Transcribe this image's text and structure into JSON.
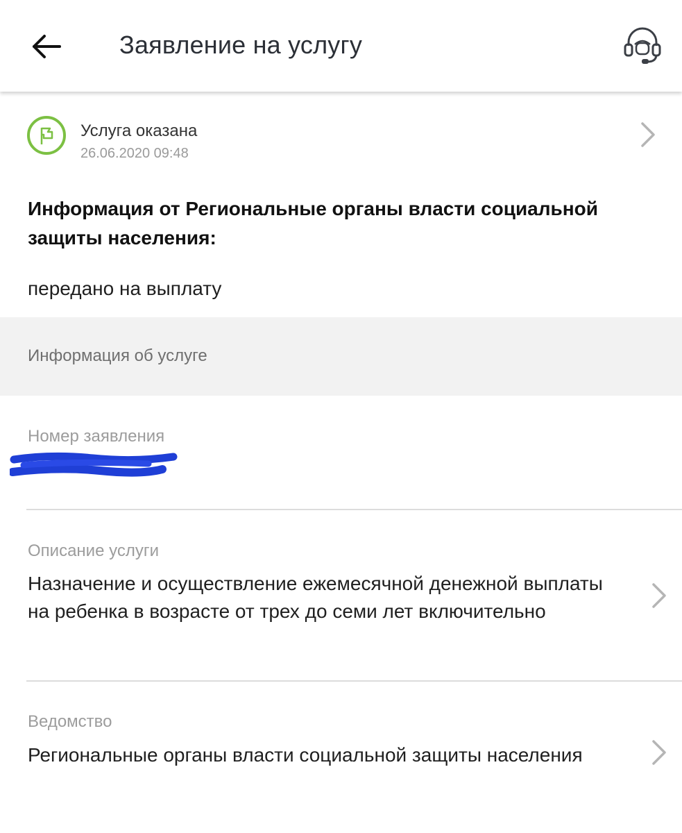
{
  "header": {
    "title": "Заявление на услугу",
    "back_icon": "arrow-left-icon",
    "support_icon": "headset-icon"
  },
  "status": {
    "title": "Услуга оказана",
    "date": "26.06.2020 09:48",
    "icon": "flag-icon",
    "icon_color": "#7cc043"
  },
  "info": {
    "heading": "Информация от Региональные органы власти социальной защиты населения:",
    "text": "передано на выплату"
  },
  "section": {
    "title": "Информация об услуге"
  },
  "fields": {
    "number": {
      "label": "Номер заявления",
      "value_state": "redacted",
      "redaction_color": "#1f3fd6"
    },
    "description": {
      "label": "Описание услуги",
      "value": "Назначение и осуществление ежемесячной денежной выплаты на ребенка в возрасте от трех до семи лет включительно"
    },
    "department": {
      "label": "Ведомство",
      "value": "Региональные органы власти социальной защиты населения"
    }
  },
  "colors": {
    "accent_green": "#7cc043",
    "band_background": "#f2f2f2",
    "muted_text": "#9c9c9c"
  }
}
